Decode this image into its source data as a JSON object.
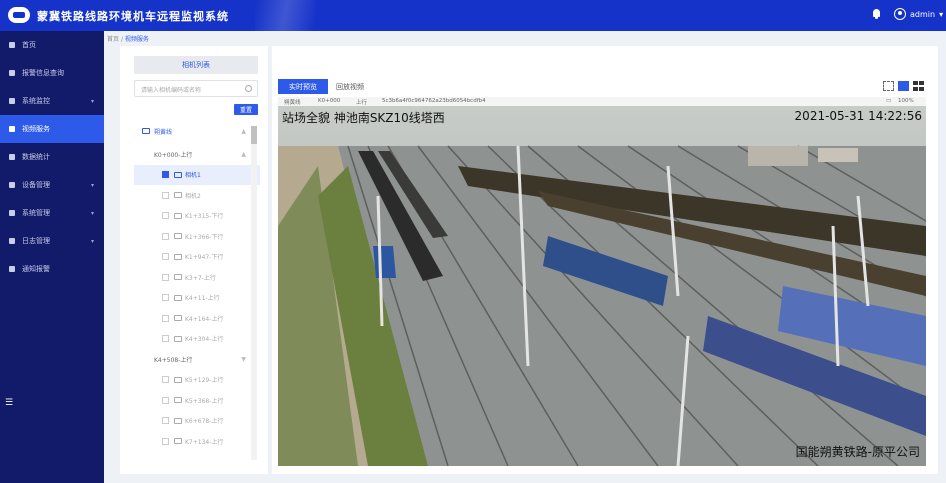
{
  "header": {
    "app_title": "蒙冀铁路线路环境机车远程监视系统",
    "username": "admin",
    "user_caret": "▾"
  },
  "sidebar": {
    "items": [
      {
        "label": "首页",
        "icon": "home-icon"
      },
      {
        "label": "报警信息查询",
        "icon": "alarm-icon"
      },
      {
        "label": "系统监控",
        "icon": "monitor-icon",
        "expandable": true
      },
      {
        "label": "视频服务",
        "icon": "video-icon",
        "active": true
      },
      {
        "label": "数据统计",
        "icon": "chart-icon"
      },
      {
        "label": "设备管理",
        "icon": "device-icon",
        "expandable": true
      },
      {
        "label": "系统管理",
        "icon": "settings-icon",
        "expandable": true
      },
      {
        "label": "日志管理",
        "icon": "log-icon",
        "expandable": true
      },
      {
        "label": "通知报警",
        "icon": "notice-icon"
      }
    ],
    "collapse_icon": "☰"
  },
  "breadcrumb": {
    "home": "首页",
    "separator": "/",
    "current": "视频服务"
  },
  "left_panel": {
    "tab_label": "相机列表",
    "search_placeholder": "请输入相机编码或名称",
    "reset_label": "重置",
    "tree": [
      {
        "type": "root",
        "label": "朔黄线",
        "toggle": "▲"
      },
      {
        "type": "group",
        "label": "K0+000-上行",
        "toggle": "▲"
      },
      {
        "type": "leaf",
        "label": "相机1",
        "selected": true
      },
      {
        "type": "leaf",
        "label": "相机2"
      },
      {
        "type": "leaf",
        "label": "K1+315-下行"
      },
      {
        "type": "leaf",
        "label": "K1+366-下行"
      },
      {
        "type": "leaf",
        "label": "K1+947-下行"
      },
      {
        "type": "leaf",
        "label": "K3+7-上行"
      },
      {
        "type": "leaf",
        "label": "K4+11-上行"
      },
      {
        "type": "leaf",
        "label": "K4+164-上行"
      },
      {
        "type": "leaf",
        "label": "K4+304-上行"
      },
      {
        "type": "group",
        "label": "K4+508-上行",
        "toggle": "▼"
      },
      {
        "type": "leaf",
        "label": "K5+129-上行"
      },
      {
        "type": "leaf",
        "label": "K5+368-上行"
      },
      {
        "type": "leaf",
        "label": "K6+678-上行"
      },
      {
        "type": "leaf",
        "label": "K7+134-上行"
      }
    ]
  },
  "right_panel": {
    "tabs": {
      "live": "实时预览",
      "playback": "回放视频"
    },
    "info_bar": {
      "line": "朔黄线",
      "station": "K0+000",
      "direction": "上行",
      "stream_id": "5c3b6a4f0c964762a23bd6054bcdfb4",
      "zoom": "100%"
    },
    "video_osd": {
      "top_left": "站场全貌 神池南SKZ10线塔西",
      "top_right": "2021-05-31 14:22:56",
      "bottom_right": "国能朔黄铁路-原平公司"
    }
  },
  "colors": {
    "header_blue": "#1532c9",
    "sidebar_navy": "#121a6a",
    "accent": "#2d5ae8"
  }
}
